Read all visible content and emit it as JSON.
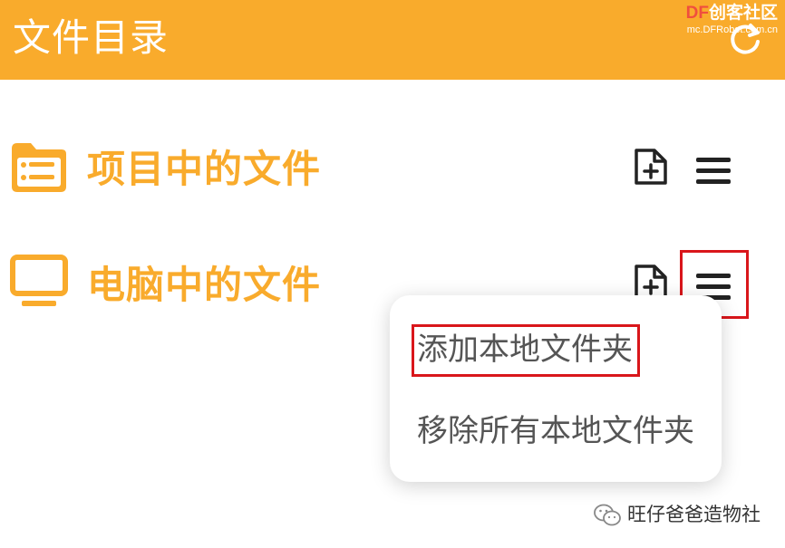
{
  "header": {
    "title": "文件目录",
    "refresh_icon": "refresh-icon",
    "watermark_brand_prefix": "DF",
    "watermark_brand_suffix": "创客社区",
    "watermark_url": "mc.DFRobot.com.cn"
  },
  "sections": [
    {
      "label": "项目中的文件",
      "icon": "folder-list-icon",
      "add_icon": "add-file-icon",
      "menu_icon": "menu-icon"
    },
    {
      "label": "电脑中的文件",
      "icon": "monitor-icon",
      "add_icon": "add-file-icon",
      "menu_icon": "menu-icon"
    }
  ],
  "dropdown": {
    "items": [
      {
        "label": "添加本地文件夹"
      },
      {
        "label": "移除所有本地文件夹"
      }
    ]
  },
  "footer_watermark": {
    "text": "旺仔爸爸造物社",
    "icon": "wechat-icon"
  },
  "colors": {
    "accent": "#f9ab2c",
    "highlight": "#d9161b",
    "icon_dark": "#222222",
    "menu_text": "#555555"
  }
}
